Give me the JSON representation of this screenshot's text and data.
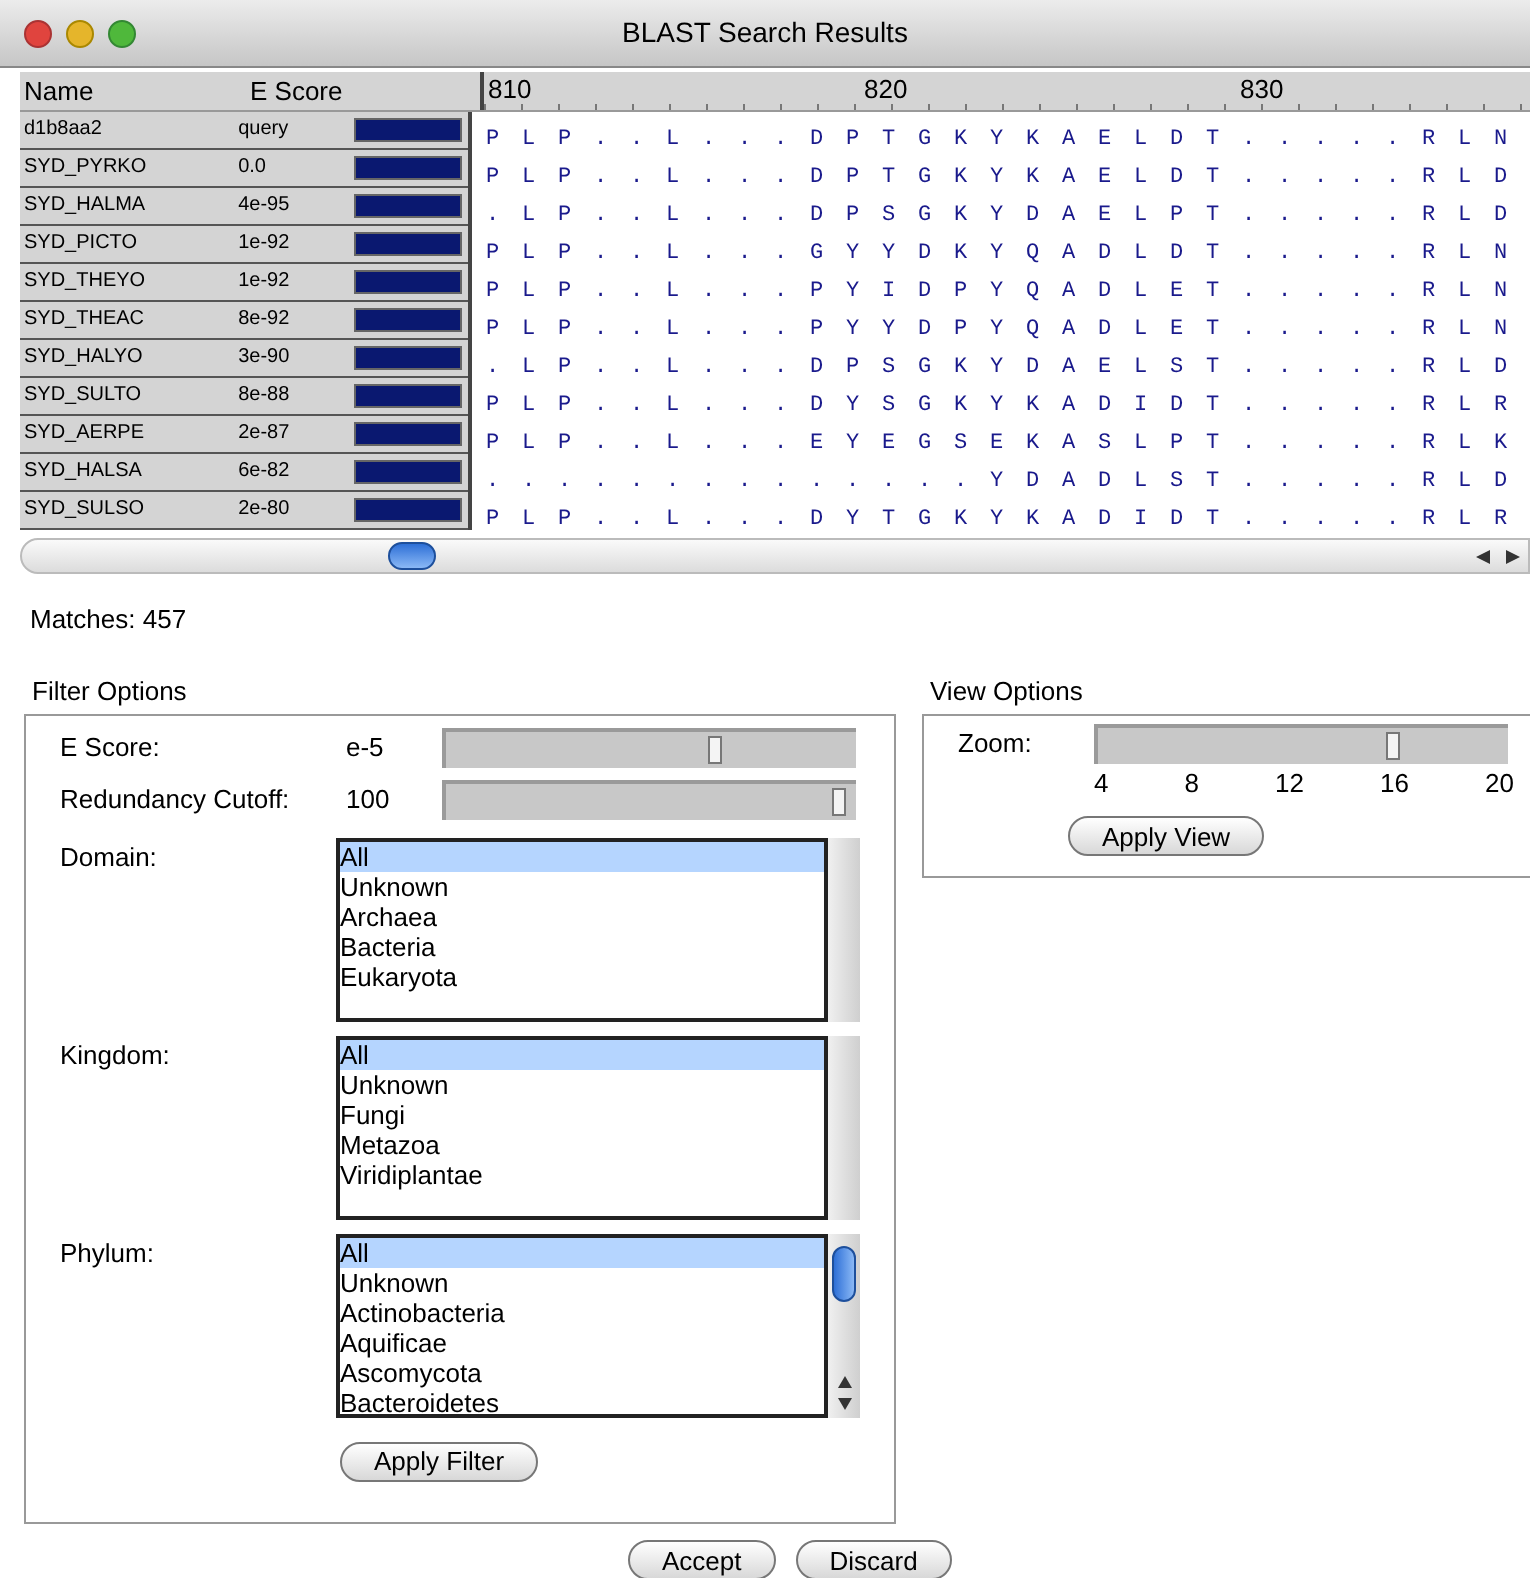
{
  "window": {
    "title": "BLAST Search Results"
  },
  "table": {
    "columns": [
      "Name",
      "E Score"
    ],
    "ruler": [
      "810",
      "820",
      "830"
    ],
    "rows": [
      {
        "name": "d1b8aa2",
        "score": "query",
        "level": 1,
        "sequence": "PLP..L...DPTGKYKAELDT.....RLN"
      },
      {
        "name": "SYD_PYRKO",
        "score": "0.0",
        "level": 1,
        "sequence": "PLP..L...DPTGKYKAELDT.....RLD"
      },
      {
        "name": "SYD_HALMA",
        "score": "4e-95",
        "level": 1,
        "sequence": ".LP..L...DPSGKYDAELPT.....RLD"
      },
      {
        "name": "SYD_PICTO",
        "score": "1e-92",
        "level": 1,
        "sequence": "PLP..L...GYYDKYQADLDT.....RLN"
      },
      {
        "name": "SYD_THEYO",
        "score": "1e-92",
        "level": 1,
        "sequence": "PLP..L...PYIDPYQADLET.....RLN"
      },
      {
        "name": "SYD_THEAC",
        "score": "8e-92",
        "level": 1,
        "sequence": "PLP..L...PYYDPYQADLET.....RLN"
      },
      {
        "name": "SYD_HALYO",
        "score": "3e-90",
        "level": 1,
        "sequence": ".LP..L...DPSGKYDAELST.....RLD"
      },
      {
        "name": "SYD_SULTO",
        "score": "8e-88",
        "level": 1,
        "sequence": "PLP..L...DYSGKYKADIDT.....RLR"
      },
      {
        "name": "SYD_AERPE",
        "score": "2e-87",
        "level": 1,
        "sequence": "PLP..L...EYEGSEKASLPT.....RLK"
      },
      {
        "name": "SYD_HALSA",
        "score": "6e-82",
        "level": 1,
        "sequence": "..............YDADLST.....RLD"
      },
      {
        "name": "SYD_SULSO",
        "score": "2e-80",
        "level": 1,
        "sequence": "PLP..L...DYTGKYKADIDT.....RLR"
      }
    ]
  },
  "matches": "Matches: 457",
  "filter_options": {
    "title": "Filter Options",
    "sliders": [
      {
        "label": "E Score:",
        "value": "e-5",
        "level": 0.68
      },
      {
        "label": "Redundancy Cutoff:",
        "value": "100",
        "level": 0.98
      }
    ],
    "lists": [
      {
        "label": "Domain:",
        "scrollable": false,
        "items": [
          {
            "text": "All",
            "selected": true
          },
          {
            "text": "Unknown",
            "selected": false
          },
          {
            "text": "Archaea",
            "selected": false
          },
          {
            "text": "Bacteria",
            "selected": false
          },
          {
            "text": "Eukaryota",
            "selected": false
          }
        ]
      },
      {
        "label": "Kingdom:",
        "scrollable": false,
        "items": [
          {
            "text": "All",
            "selected": true
          },
          {
            "text": "Unknown",
            "selected": false
          },
          {
            "text": "Fungi",
            "selected": false
          },
          {
            "text": "Metazoa",
            "selected": false
          },
          {
            "text": "Viridiplantae",
            "selected": false
          }
        ]
      },
      {
        "label": "Phylum:",
        "scrollable": true,
        "items": [
          {
            "text": "All",
            "selected": true
          },
          {
            "text": "Unknown",
            "selected": false
          },
          {
            "text": "Actinobacteria",
            "selected": false
          },
          {
            "text": "Aquificae",
            "selected": false
          },
          {
            "text": "Ascomycota",
            "selected": false
          },
          {
            "text": "Bacteroidetes",
            "selected": false
          }
        ]
      }
    ],
    "button": "Apply Filter"
  },
  "view_options": {
    "title": "View Options",
    "label": "Zoom:",
    "level": 0.74,
    "ticks": [
      "4",
      "8",
      "12",
      "16",
      "20"
    ],
    "button": "Apply View"
  },
  "buttons": [
    "Accept",
    "Discard"
  ]
}
